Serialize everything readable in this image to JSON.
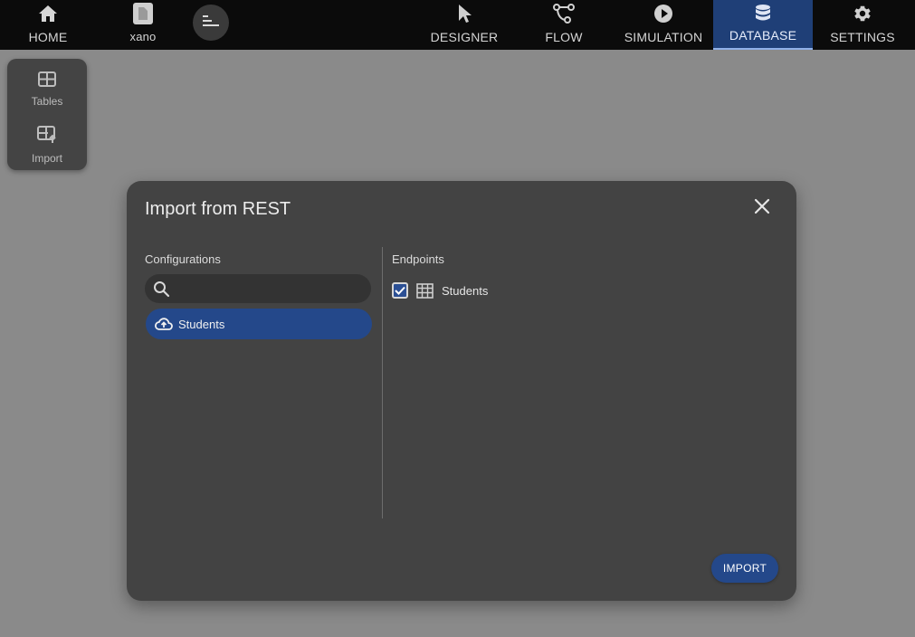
{
  "nav": {
    "home_label": "HOME",
    "project_label": "xano",
    "designer_label": "DESIGNER",
    "flow_label": "FLOW",
    "simulation_label": "SIMULATION",
    "database_label": "DATABASE",
    "settings_label": "SETTINGS",
    "active": "DATABASE"
  },
  "side_panel": {
    "tables_label": "Tables",
    "import_label": "Import"
  },
  "dialog": {
    "title": "Import from REST",
    "configurations_label": "Configurations",
    "search_value": "",
    "configurations": [
      {
        "label": "Students",
        "icon": "cloud-upload-icon",
        "selected": true
      }
    ],
    "endpoints_label": "Endpoints",
    "endpoints": [
      {
        "label": "Students",
        "icon": "table-icon",
        "checked": true
      }
    ],
    "import_label": "IMPORT"
  },
  "colors": {
    "accent": "#24488a",
    "topbar": "#0b0b0b",
    "dialog": "#434343",
    "overlay": "#8a8a8a"
  }
}
